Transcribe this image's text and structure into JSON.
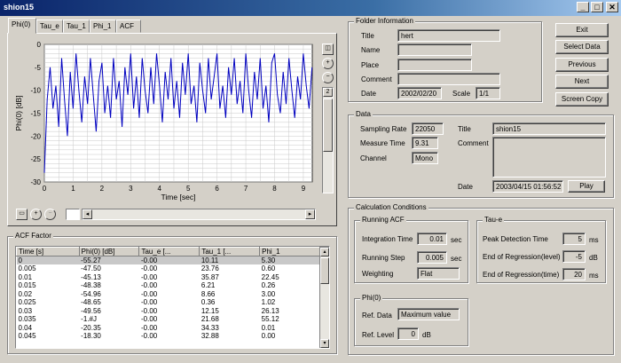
{
  "window": {
    "title": "shion15",
    "buttons": [
      "_",
      "□",
      "✕"
    ]
  },
  "tabs": [
    "Phi(0)",
    "Tau_e",
    "Tau_1",
    "Phi_1",
    "ACF"
  ],
  "active_tab": 0,
  "chart_data": {
    "type": "line",
    "ylabel": "Phi(0) [dB]",
    "xlabel": "Time [sec]",
    "xlim": [
      0,
      9.31
    ],
    "ylim": [
      -30,
      0
    ],
    "xticks": [
      "0",
      "1",
      "2",
      "3",
      "4",
      "5",
      "6",
      "7",
      "8",
      "9"
    ],
    "yticks": [
      "0",
      "-5",
      "-10",
      "-15",
      "-20",
      "-25",
      "-30"
    ],
    "grid": true,
    "series_color": "#0000c0",
    "series": [
      {
        "x": [
          0,
          0.1,
          0.2,
          0.3,
          0.4,
          0.5,
          0.6,
          0.7,
          0.8,
          0.9,
          1.0,
          1.1,
          1.2,
          1.3,
          1.4,
          1.5,
          1.6,
          1.7,
          1.8,
          1.9,
          2.0,
          2.1,
          2.2,
          2.3,
          2.4,
          2.5,
          2.6,
          2.7,
          2.8,
          2.9,
          3.0,
          3.1,
          3.2,
          3.3,
          3.4,
          3.5,
          3.6,
          3.7,
          3.8,
          3.9,
          4.0,
          4.1,
          4.2,
          4.3,
          4.4,
          4.5,
          4.6,
          4.7,
          4.8,
          4.9,
          5.0,
          5.1,
          5.2,
          5.3,
          5.4,
          5.5,
          5.6,
          5.7,
          5.8,
          5.9,
          6.0,
          6.1,
          6.2,
          6.3,
          6.4,
          6.5,
          6.6,
          6.7,
          6.8,
          6.9,
          7.0,
          7.1,
          7.2,
          7.3,
          7.4,
          7.5,
          7.6,
          7.7,
          7.8,
          7.9,
          8.0,
          8.1,
          8.2,
          8.3,
          8.4,
          8.5,
          8.6,
          8.7,
          8.8,
          8.9,
          9.0,
          9.1,
          9.2,
          9.3
        ],
        "y": [
          -28,
          -12,
          -5,
          -14,
          -9,
          -18,
          -3,
          -12,
          -20,
          -6,
          -14,
          -2,
          -10,
          -17,
          -7,
          -13,
          -3,
          -11,
          -19,
          -8,
          -4,
          -15,
          -9,
          -16,
          -3,
          -12,
          -8,
          -18,
          -5,
          -11,
          -2,
          -14,
          -7,
          -16,
          -3,
          -10,
          -15,
          -5,
          -13,
          -2,
          -9,
          -17,
          -6,
          -12,
          -3,
          -14,
          -8,
          -16,
          -4,
          -11,
          -2,
          -13,
          -9,
          -17,
          -4,
          -10,
          -15,
          -3,
          -12,
          -7,
          -2,
          -14,
          -9,
          -16,
          -5,
          -11,
          -3,
          -13,
          -8,
          -15,
          -2,
          -10,
          -16,
          -6,
          -12,
          -3,
          -14,
          -9,
          -17,
          -4,
          -2,
          -11,
          -15,
          -6,
          -13,
          -3,
          -10,
          -16,
          -7,
          -12,
          -2,
          -9,
          -14,
          -5
        ]
      }
    ]
  },
  "plot_side": {
    "page_value": "2"
  },
  "acf": {
    "title": "ACF Factor",
    "columns": [
      "Time [s]",
      "Phi(0) [dB]",
      "Tau_e [...",
      "Tau_1 [...",
      "Phi_1"
    ],
    "rows": [
      [
        "0",
        "-55.27",
        "-0.00",
        "10.11",
        "5.30"
      ],
      [
        "0.005",
        "-47.50",
        "-0.00",
        "23.76",
        "0.60"
      ],
      [
        "0.01",
        "-45.13",
        "-0.00",
        "35.87",
        "22.45"
      ],
      [
        "0.015",
        "-48.38",
        "-0.00",
        "6.21",
        "0.26"
      ],
      [
        "0.02",
        "-54.96",
        "-0.00",
        "8.66",
        "3.00"
      ],
      [
        "0.025",
        "-48.65",
        "-0.00",
        "0.36",
        "1.02"
      ],
      [
        "0.03",
        "-49.56",
        "-0.00",
        "12.15",
        "26.13"
      ],
      [
        "0.035",
        "-1.#J",
        "-0.00",
        "21.68",
        "55.12"
      ],
      [
        "0.04",
        "-20.35",
        "-0.00",
        "34.33",
        "0.01"
      ],
      [
        "0.045",
        "-18.30",
        "-0.00",
        "32.88",
        "0.00"
      ]
    ]
  },
  "folder": {
    "legend": "Folder Information",
    "title_label": "Title",
    "title_value": "hert",
    "name_label": "Name",
    "name_value": "",
    "place_label": "Place",
    "place_value": "",
    "comment_label": "Comment",
    "comment_value": "",
    "date_label": "Date",
    "date_value": "2002/02/20",
    "scale_label": "Scale",
    "scale_value": "1/1"
  },
  "buttons": {
    "exit": "Exit",
    "select": "Select Data",
    "previous": "Previous",
    "next": "Next",
    "screen_copy": "Screen Copy",
    "play": "Play"
  },
  "data": {
    "legend": "Data",
    "sampling_rate_label": "Sampling Rate",
    "sampling_rate": "22050",
    "measure_time_label": "Measure Time",
    "measure_time": "9.31",
    "channel_label": "Channel",
    "channel": "Mono",
    "title_label": "Title",
    "title": "shion15",
    "comment_label": "Comment",
    "comment": "",
    "date_label": "Date",
    "date": "2003/04/15 01:56:52"
  },
  "calc": {
    "legend": "Calculation Conditions",
    "running_acf": {
      "legend": "Running ACF",
      "integration_label": "Integration Time",
      "integration": "0.01",
      "integration_unit": "sec",
      "step_label": "Running Step",
      "step": "0.005",
      "step_unit": "sec",
      "weighting_label": "Weighting",
      "weighting": "Flat"
    },
    "taue": {
      "legend": "Tau-e",
      "peak_label": "Peak Detection Time",
      "peak": "5",
      "peak_unit": "ms",
      "eor_level_label": "End of Regression(level)",
      "eor_level": "-5",
      "eor_level_unit": "dB",
      "eor_time_label": "End of Regression(time)",
      "eor_time": "20",
      "eor_time_unit": "ms"
    },
    "phi0": {
      "legend": "Phi(0)",
      "ref_data_label": "Ref. Data",
      "ref_data": "Maximum value",
      "ref_level_label": "Ref. Level",
      "ref_level": "0",
      "ref_level_unit": "dB"
    }
  }
}
